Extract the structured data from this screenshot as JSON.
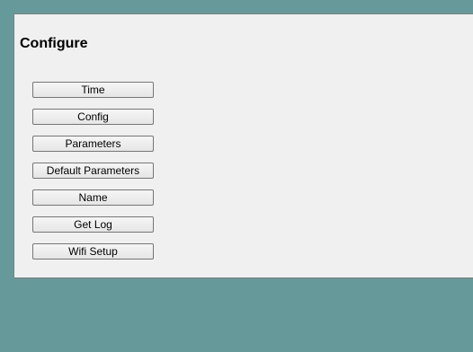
{
  "page": {
    "title": "Configure"
  },
  "buttons": [
    {
      "label": "Time"
    },
    {
      "label": "Config"
    },
    {
      "label": "Parameters"
    },
    {
      "label": "Default Parameters"
    },
    {
      "label": "Name"
    },
    {
      "label": "Get Log"
    },
    {
      "label": "Wifi Setup"
    }
  ],
  "colors": {
    "background": "#669999",
    "panel": "#f0f0f0",
    "button_border": "#767676"
  }
}
